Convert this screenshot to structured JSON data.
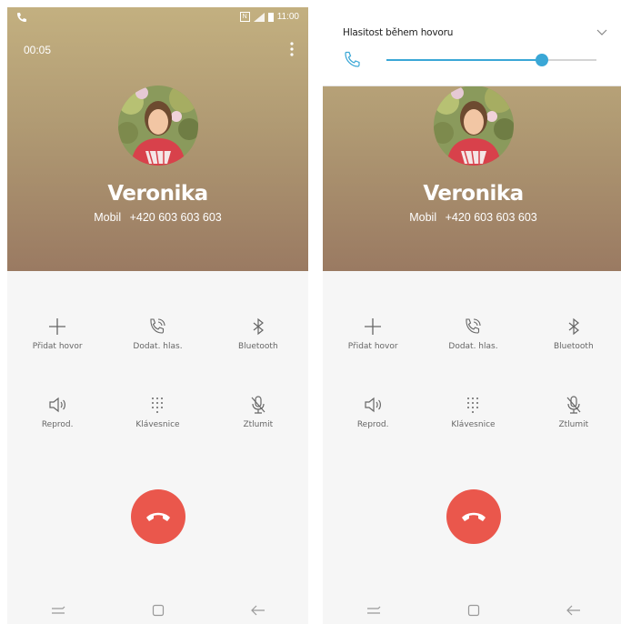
{
  "screens": [
    {
      "status_time": "11:00",
      "call_timer": "00:05",
      "contact_name": "Veronika",
      "number_label": "Mobil",
      "phone_number": "+420 603 603 603",
      "actions": [
        {
          "label": "Přidat hovor",
          "icon": "plus-icon"
        },
        {
          "label": "Dodat. hlas.",
          "icon": "extra-volume-icon"
        },
        {
          "label": "Bluetooth",
          "icon": "bluetooth-icon"
        },
        {
          "label": "Reprod.",
          "icon": "speaker-icon"
        },
        {
          "label": "Klávesnice",
          "icon": "keypad-icon"
        },
        {
          "label": "Ztlumit",
          "icon": "mute-icon"
        }
      ]
    },
    {
      "volume_panel": {
        "title": "Hlasitost během hovoru",
        "level": 0.74
      },
      "contact_name": "Veronika",
      "number_label": "Mobil",
      "phone_number": "+420 603 603 603",
      "actions": [
        {
          "label": "Přidat hovor",
          "icon": "plus-icon"
        },
        {
          "label": "Dodat. hlas.",
          "icon": "extra-volume-icon"
        },
        {
          "label": "Bluetooth",
          "icon": "bluetooth-icon"
        },
        {
          "label": "Reprod.",
          "icon": "speaker-icon"
        },
        {
          "label": "Klávesnice",
          "icon": "keypad-icon"
        },
        {
          "label": "Ztlumit",
          "icon": "mute-icon"
        }
      ]
    }
  ],
  "colors": {
    "end_call": "#ea574c",
    "volume_accent": "#3aa7d6",
    "header_top": "#c3b080",
    "header_bottom": "#9a7a62"
  }
}
